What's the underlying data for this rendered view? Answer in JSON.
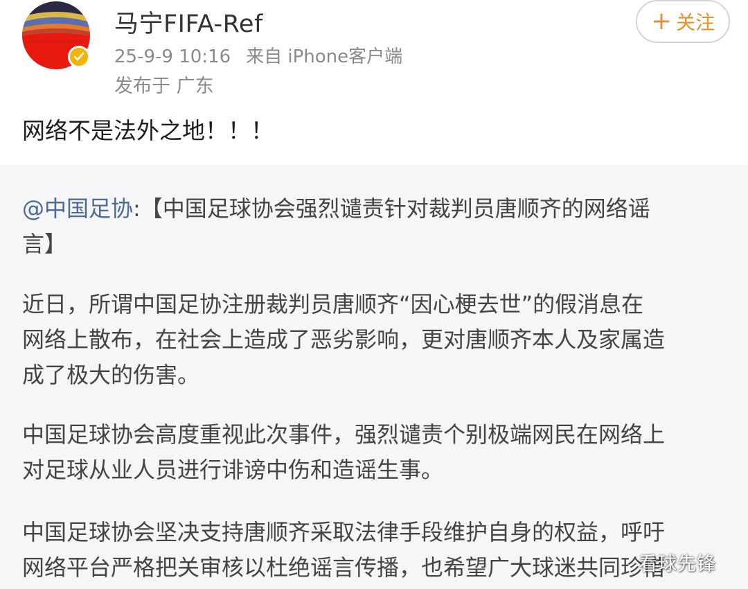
{
  "author": {
    "name": "马宁FIFA-Ref",
    "verified": true,
    "avatar_icon": "stadium-crowd-avatar"
  },
  "meta": {
    "timestamp": "25-9-9 10:16",
    "source": "来自 iPhone客户端",
    "location": "发布于 广东"
  },
  "follow_button": {
    "plus": "+",
    "label": "关注"
  },
  "post_text": "网络不是法外之地！！！",
  "repost": {
    "mention": "@中国足协",
    "title_lines": [
      ":【中国足球协会强烈谴责针对裁判员唐顺齐的网络谣",
      "言】"
    ],
    "paragraphs": [
      [
        "近日，所谓中国足协注册裁判员唐顺齐“因心梗去世”的假消息在",
        "网络上散布，在社会上造成了恶劣影响，更对唐顺齐本人及家属造",
        "成了极大的伤害。"
      ],
      [
        "中国足球协会高度重视此次事件，强烈谴责个别极端网民在网络上",
        "对足球从业人员进行诽谤中伤和造谣生事。"
      ],
      [
        "中国足球协会坚决支持唐顺齐采取法律手段维护自身的权益，呼吁",
        "网络平台严格把关审核以杜绝谣言传播，也希望广大球迷共同珍惜"
      ]
    ]
  },
  "watermark": "看球先锋",
  "colors": {
    "accent_orange": "#e8902e",
    "meta_gray": "#8a8a8a",
    "repost_bg": "#f6f5f7",
    "mention_blue": "#4a6a9a",
    "badge_gold": "#f5b400"
  }
}
